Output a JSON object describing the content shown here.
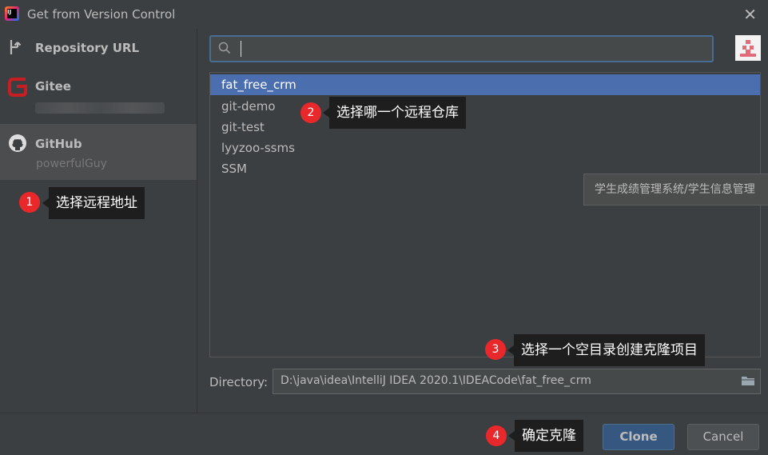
{
  "window": {
    "title": "Get from Version Control"
  },
  "sidebar": {
    "items": [
      {
        "label": "Repository URL"
      },
      {
        "label": "Gitee"
      },
      {
        "label": "GitHub",
        "account": "powerfulGuy"
      }
    ]
  },
  "search": {
    "value": "",
    "placeholder": ""
  },
  "repos": [
    "fat_free_crm",
    "git-demo",
    "git-test",
    "lyyzoo-ssms",
    "SSM"
  ],
  "selected_repo": "fat_free_crm",
  "description_tooltip": "学生成绩管理系统/学生信息管理",
  "directory": {
    "label": "Directory:",
    "value": "D:\\java\\idea\\IntelliJ IDEA 2020.1\\IDEACode\\fat_free_crm"
  },
  "buttons": {
    "clone": "Clone",
    "cancel": "Cancel"
  },
  "annotations": [
    {
      "num": "1",
      "text": "选择远程地址"
    },
    {
      "num": "2",
      "text": "选择哪一个远程仓库"
    },
    {
      "num": "3",
      "text": "选择一个空目录创建克隆项目"
    },
    {
      "num": "4",
      "text": "确定克隆"
    }
  ],
  "colors": {
    "selection": "#4b6eaf",
    "badge": "#e8282b",
    "background": "#3c3f41"
  }
}
